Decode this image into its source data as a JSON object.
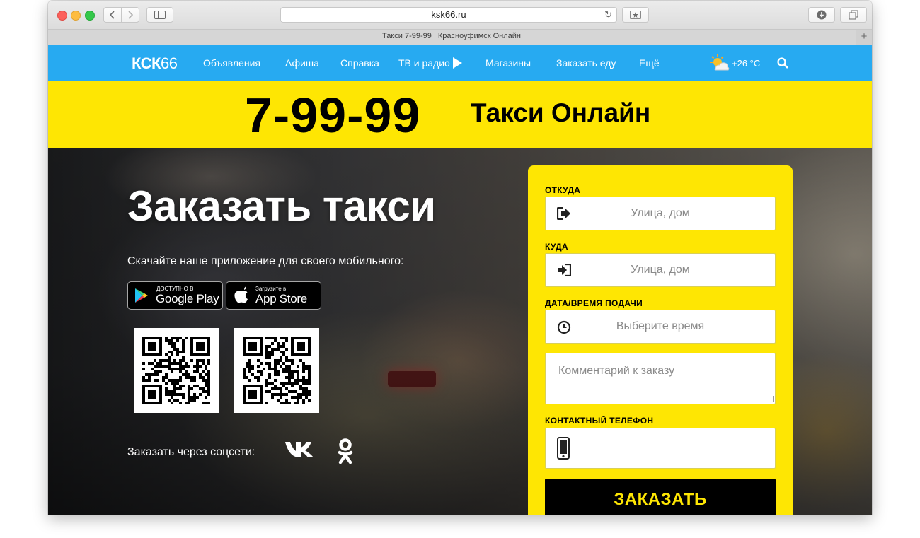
{
  "browser": {
    "url": "ksk66.ru",
    "tab_title": "Такси 7-99-99 | Красноуфимск Онлайн",
    "new_tab": "+"
  },
  "nav": {
    "logo_letters": "КСК",
    "logo_number": "66",
    "items": [
      "Объявления",
      "Афиша",
      "Справка",
      "ТВ и радио",
      "Магазины",
      "Заказать еду",
      "Ещё"
    ],
    "temperature": "+26 °C",
    "bg_color": "#27aaf1"
  },
  "banner": {
    "phone": "7-99-99",
    "title": "Такси Онлайн",
    "bg_color": "#fee603"
  },
  "hero": {
    "title": "Заказать такси",
    "subtitle": "Скачайте наше приложение для своего мобильного:",
    "google_play_small": "ДОСТУПНО В",
    "google_play_big": "Google Play",
    "app_store_small": "Загрузите в",
    "app_store_big": "App Store",
    "social_label": "Заказать через соцсети:"
  },
  "form": {
    "from_label": "ОТКУДА",
    "from_placeholder": "Улица, дом",
    "to_label": "КУДА",
    "to_placeholder": "Улица, дом",
    "datetime_label": "ДАТА/ВРЕМЯ ПОДАЧИ",
    "datetime_placeholder": "Выберите время",
    "comment_placeholder": "Комментарий к заказу",
    "phone_label": "КОНТАКТНЫЙ ТЕЛЕФОН",
    "submit_label": "ЗАКАЗАТЬ"
  },
  "icons": {
    "weather": "sun-cloud-icon",
    "search": "search-icon",
    "from": "sign-out-icon",
    "to": "sign-in-icon",
    "time": "clock-icon",
    "phone": "mobile-phone-icon",
    "vk": "vk-icon",
    "ok": "odnoklassniki-icon"
  }
}
